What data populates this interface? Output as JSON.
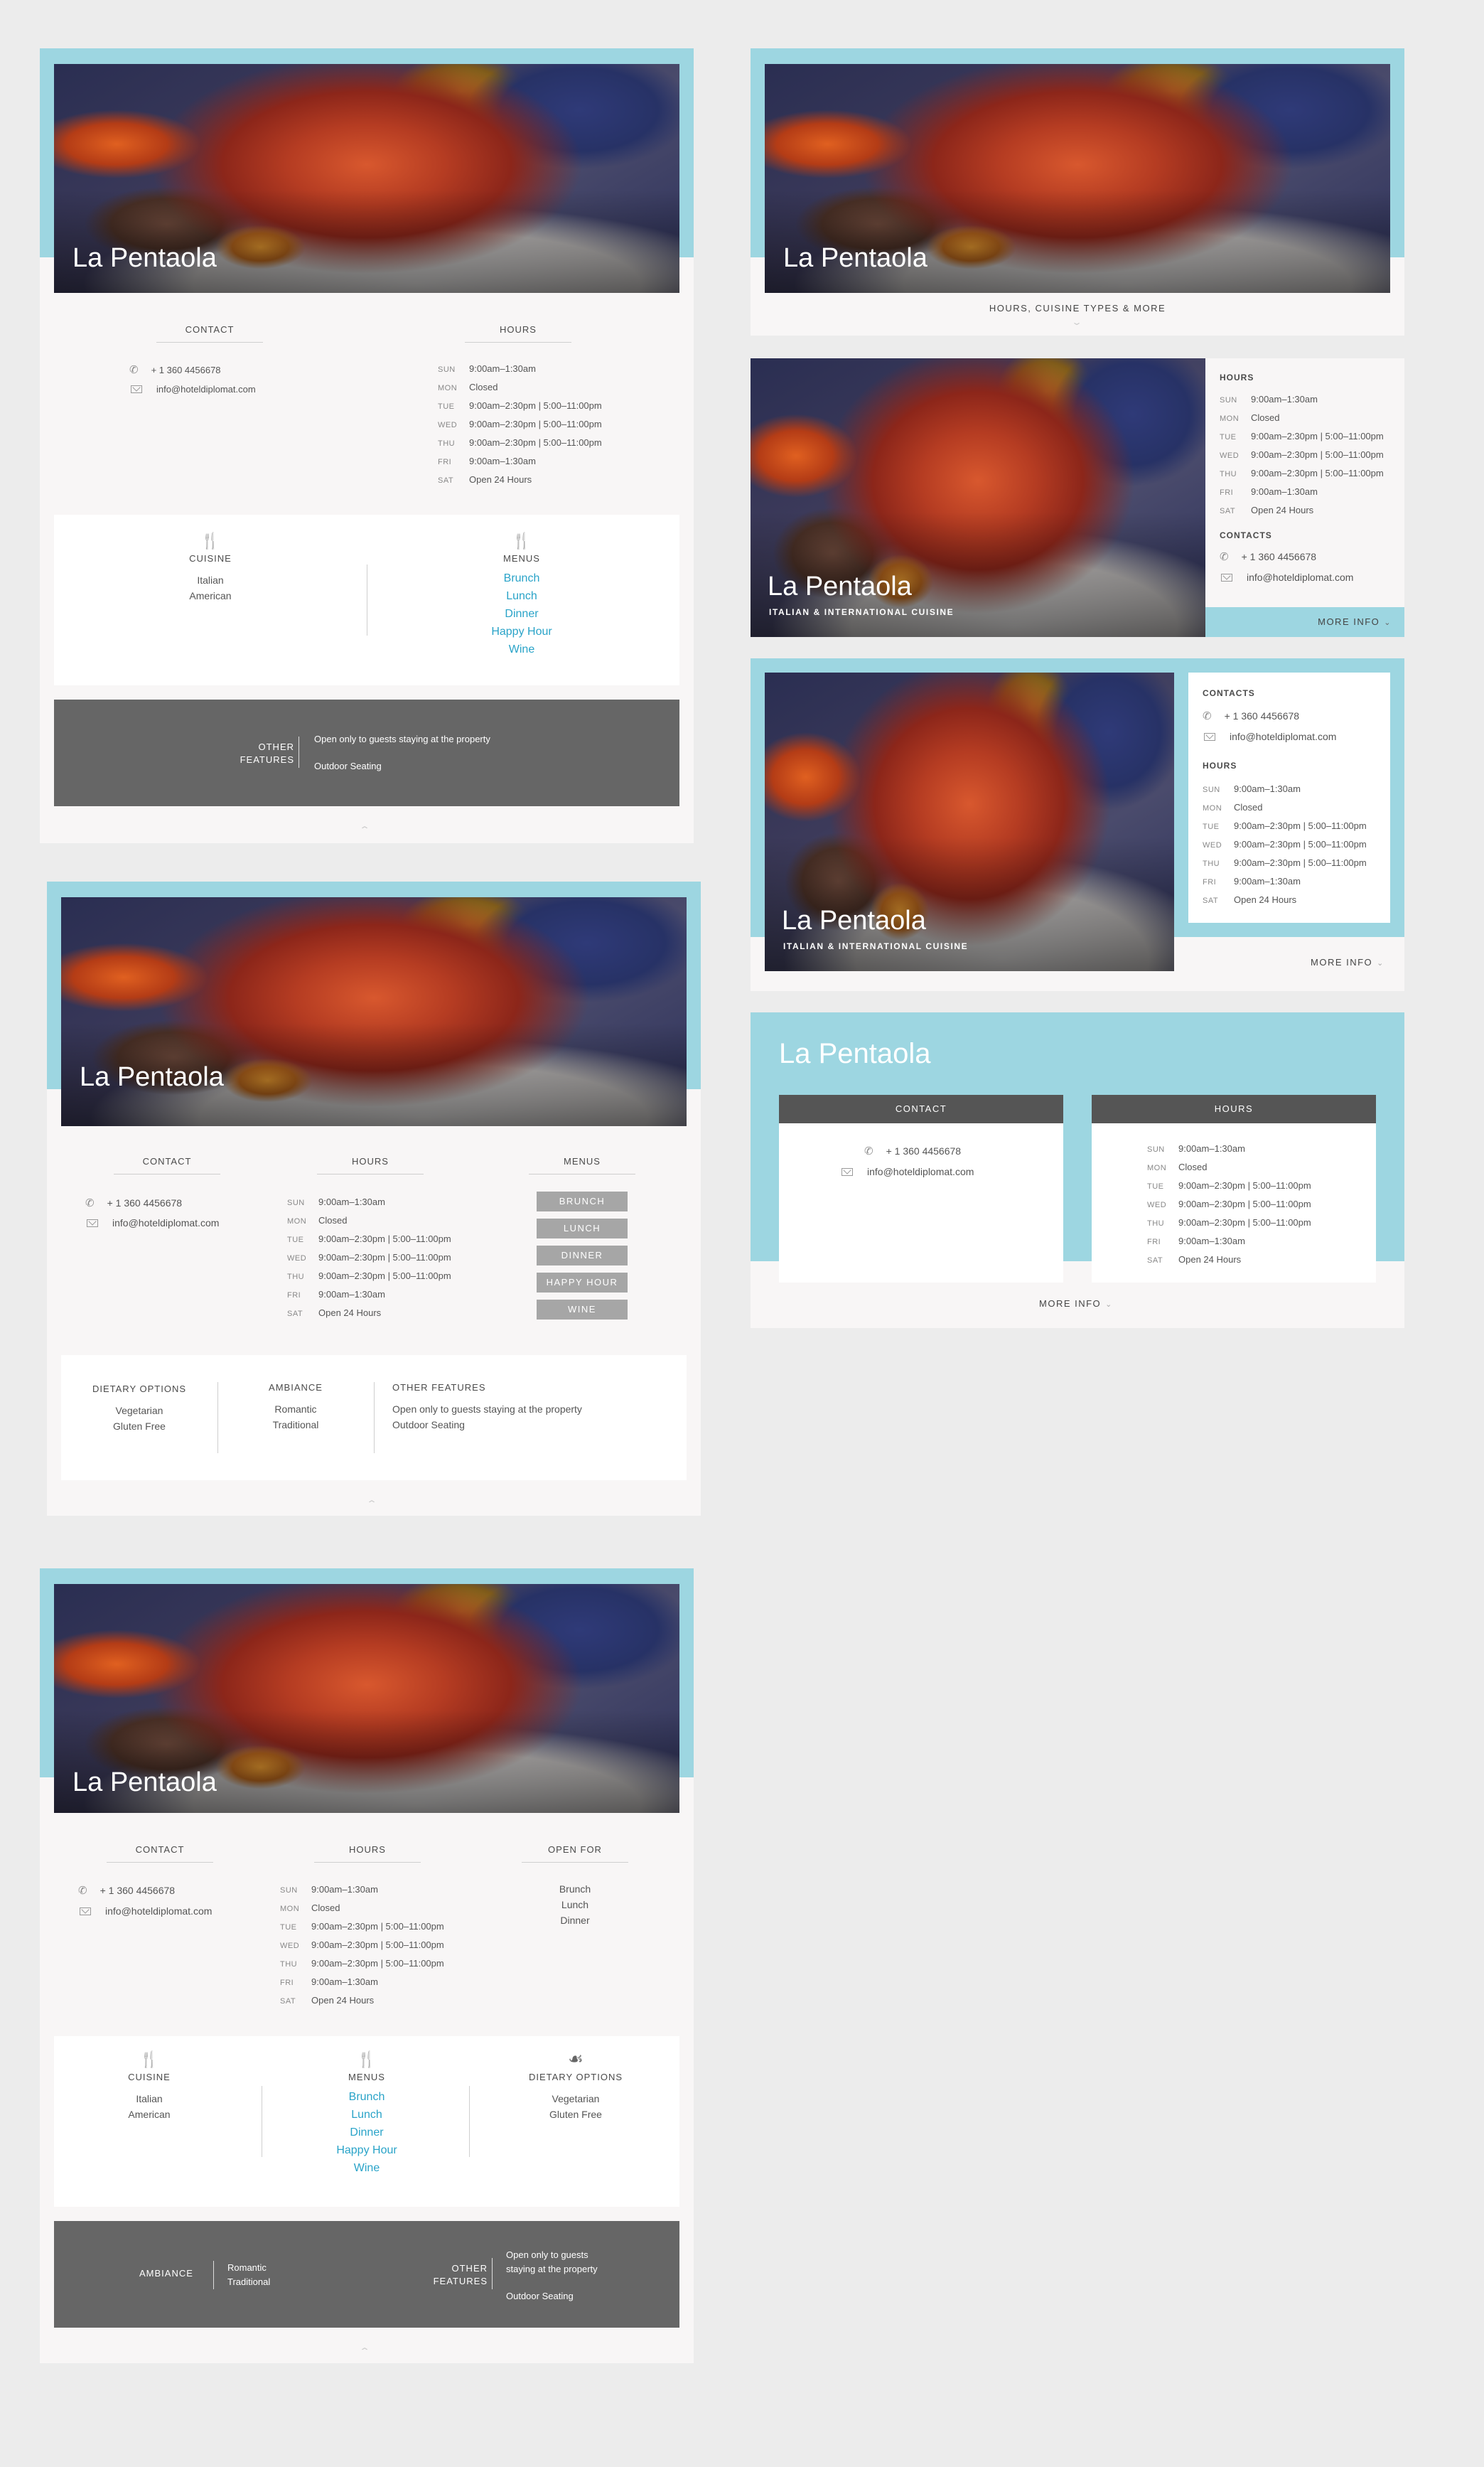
{
  "restaurant": {
    "name": "La Pentaola",
    "subtitle": "ITALIAN & INTERNATIONAL CUISINE"
  },
  "labels": {
    "contact": "CONTACT",
    "contacts": "CONTACTS",
    "hours": "HOURS",
    "menus": "MENUS",
    "cuisine": "CUISINE",
    "open_for": "OPEN FOR",
    "dietary_options": "DIETARY OPTIONS",
    "ambiance": "AMBIANCE",
    "other_features": "OTHER FEATURES",
    "other": "OTHER",
    "features": "FEATURES",
    "more_info": "MORE INFO",
    "teaser": "HOURS, CUISINE TYPES & MORE"
  },
  "contact": {
    "phone": "+ 1 360 4456678",
    "email": "info@hoteldiplomat.com"
  },
  "hours": [
    {
      "day": "SUN",
      "time": "9:00am–1:30am"
    },
    {
      "day": "MON",
      "time": "Closed"
    },
    {
      "day": "TUE",
      "time": "9:00am–2:30pm | 5:00–11:00pm"
    },
    {
      "day": "WED",
      "time": "9:00am–2:30pm | 5:00–11:00pm"
    },
    {
      "day": "THU",
      "time": "9:00am–2:30pm | 5:00–11:00pm"
    },
    {
      "day": "FRI",
      "time": "9:00am–1:30am"
    },
    {
      "day": "SAT",
      "time": "Open 24 Hours"
    }
  ],
  "cuisine": [
    "Italian",
    "American"
  ],
  "menus": [
    "Brunch",
    "Lunch",
    "Dinner",
    "Happy Hour",
    "Wine"
  ],
  "menu_buttons": [
    "BRUNCH",
    "LUNCH",
    "DINNER",
    "HAPPY HOUR",
    "WINE"
  ],
  "open_for": [
    "Brunch",
    "Lunch",
    "Dinner"
  ],
  "dietary": [
    "Vegetarian",
    "Gluten Free"
  ],
  "ambiance": [
    "Romantic",
    "Traditional"
  ],
  "features": [
    "Open only to guests staying at the property",
    "Outdoor Seating"
  ],
  "features_wrapped": [
    "Open only to guests",
    "staying at the property"
  ],
  "colors": {
    "accent_band": "#9dd6e1",
    "link": "#29a3c8",
    "dark_panel": "#666666",
    "card_bg": "#f8f6f6",
    "page_bg": "#ececec"
  },
  "icons": [
    "fork-knife-icon",
    "apple-icon",
    "phone-icon",
    "mail-icon",
    "chevron-down-icon",
    "chevron-up-icon"
  ]
}
